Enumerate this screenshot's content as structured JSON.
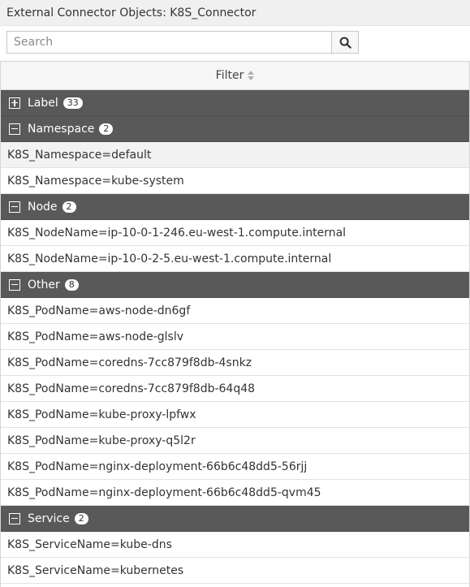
{
  "window": {
    "title": "External Connector Objects: K8S_Connector"
  },
  "search": {
    "placeholder": "Search",
    "value": ""
  },
  "table": {
    "column_header": "Filter",
    "groups": [
      {
        "name": "Label",
        "count": "33",
        "expanded": false,
        "rows": []
      },
      {
        "name": "Namespace",
        "count": "2",
        "expanded": true,
        "rows": [
          "K8S_Namespace=default",
          "K8S_Namespace=kube-system"
        ]
      },
      {
        "name": "Node",
        "count": "2",
        "expanded": true,
        "rows": [
          "K8S_NodeName=ip-10-0-1-246.eu-west-1.compute.internal",
          "K8S_NodeName=ip-10-0-2-5.eu-west-1.compute.internal"
        ]
      },
      {
        "name": "Other",
        "count": "8",
        "expanded": true,
        "rows": [
          "K8S_PodName=aws-node-dn6gf",
          "K8S_PodName=aws-node-glslv",
          "K8S_PodName=coredns-7cc879f8db-4snkz",
          "K8S_PodName=coredns-7cc879f8db-64q48",
          "K8S_PodName=kube-proxy-lpfwx",
          "K8S_PodName=kube-proxy-q5l2r",
          "K8S_PodName=nginx-deployment-66b6c48dd5-56rjj",
          "K8S_PodName=nginx-deployment-66b6c48dd5-qvm45"
        ]
      },
      {
        "name": "Service",
        "count": "2",
        "expanded": true,
        "rows": [
          "K8S_ServiceName=kube-dns",
          "K8S_ServiceName=kubernetes"
        ]
      }
    ]
  },
  "colors": {
    "group_header_bg": "#595959",
    "title_bar_bg": "#f0f0f0",
    "highlighted_row_bg": "#f2f2f2"
  },
  "icons": {
    "search": "search-icon",
    "sort": "sort-icon",
    "expand": "expand-icon",
    "collapse": "collapse-icon"
  }
}
